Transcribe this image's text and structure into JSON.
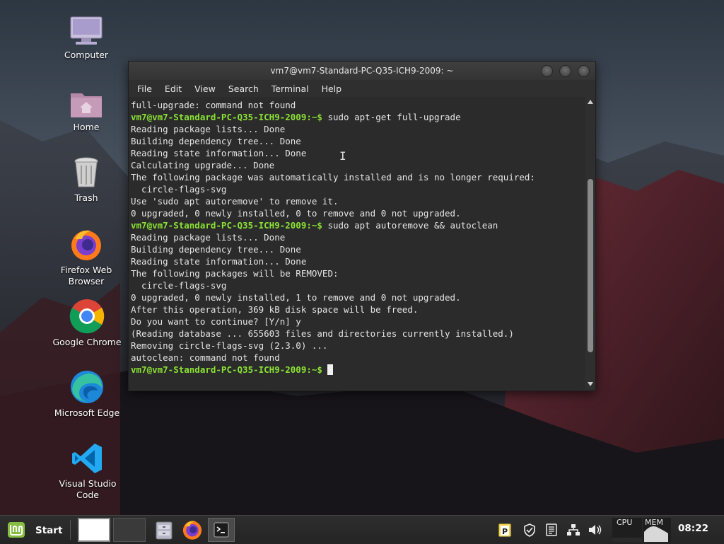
{
  "desktop": {
    "icons": [
      {
        "label": "Computer",
        "icon": "computer-icon"
      },
      {
        "label": "Home",
        "icon": "home-folder-icon"
      },
      {
        "label": "Trash",
        "icon": "trash-icon"
      },
      {
        "label": "Firefox Web Browser",
        "icon": "firefox-icon"
      },
      {
        "label": "Google Chrome",
        "icon": "chrome-icon"
      },
      {
        "label": "Microsoft Edge",
        "icon": "edge-icon"
      },
      {
        "label": "Visual Studio Code",
        "icon": "vscode-icon"
      }
    ]
  },
  "terminal": {
    "title": "vm7@vm7-Standard-PC-Q35-ICH9-2009: ~",
    "menu": [
      "File",
      "Edit",
      "View",
      "Search",
      "Terminal",
      "Help"
    ],
    "prompt": "vm7@vm7-Standard-PC-Q35-ICH9-2009:~$",
    "lines": [
      {
        "text": "full-upgrade: command not found"
      },
      {
        "prompt": true,
        "text": " sudo apt-get full-upgrade"
      },
      {
        "text": "Reading package lists... Done"
      },
      {
        "text": "Building dependency tree... Done"
      },
      {
        "text": "Reading state information... Done"
      },
      {
        "text": "Calculating upgrade... Done"
      },
      {
        "text": "The following package was automatically installed and is no longer required:"
      },
      {
        "text": "  circle-flags-svg"
      },
      {
        "text": "Use 'sudo apt autoremove' to remove it."
      },
      {
        "text": "0 upgraded, 0 newly installed, 0 to remove and 0 not upgraded."
      },
      {
        "prompt": true,
        "text": " sudo apt autoremove && autoclean"
      },
      {
        "text": "Reading package lists... Done"
      },
      {
        "text": "Building dependency tree... Done"
      },
      {
        "text": "Reading state information... Done"
      },
      {
        "text": "The following packages will be REMOVED:"
      },
      {
        "text": "  circle-flags-svg"
      },
      {
        "text": "0 upgraded, 0 newly installed, 1 to remove and 0 not upgraded."
      },
      {
        "text": "After this operation, 369 kB disk space will be freed."
      },
      {
        "text": "Do you want to continue? [Y/n] y"
      },
      {
        "text": "(Reading database ... 655603 files and directories currently installed.)"
      },
      {
        "text": "Removing circle-flags-svg (2.3.0) ..."
      },
      {
        "text": "autoclean: command not found"
      },
      {
        "prompt": true,
        "text": " ",
        "cursor": true
      }
    ],
    "scroll_position": 0.72
  },
  "taskbar": {
    "start_label": "Start",
    "cpu_label": "CPU",
    "mem_label": "MEM",
    "clock": "08:22"
  },
  "colors": {
    "prompt": "#8ae234",
    "terminal_bg": "#2b2b2b",
    "mint_green": "#86be43"
  }
}
